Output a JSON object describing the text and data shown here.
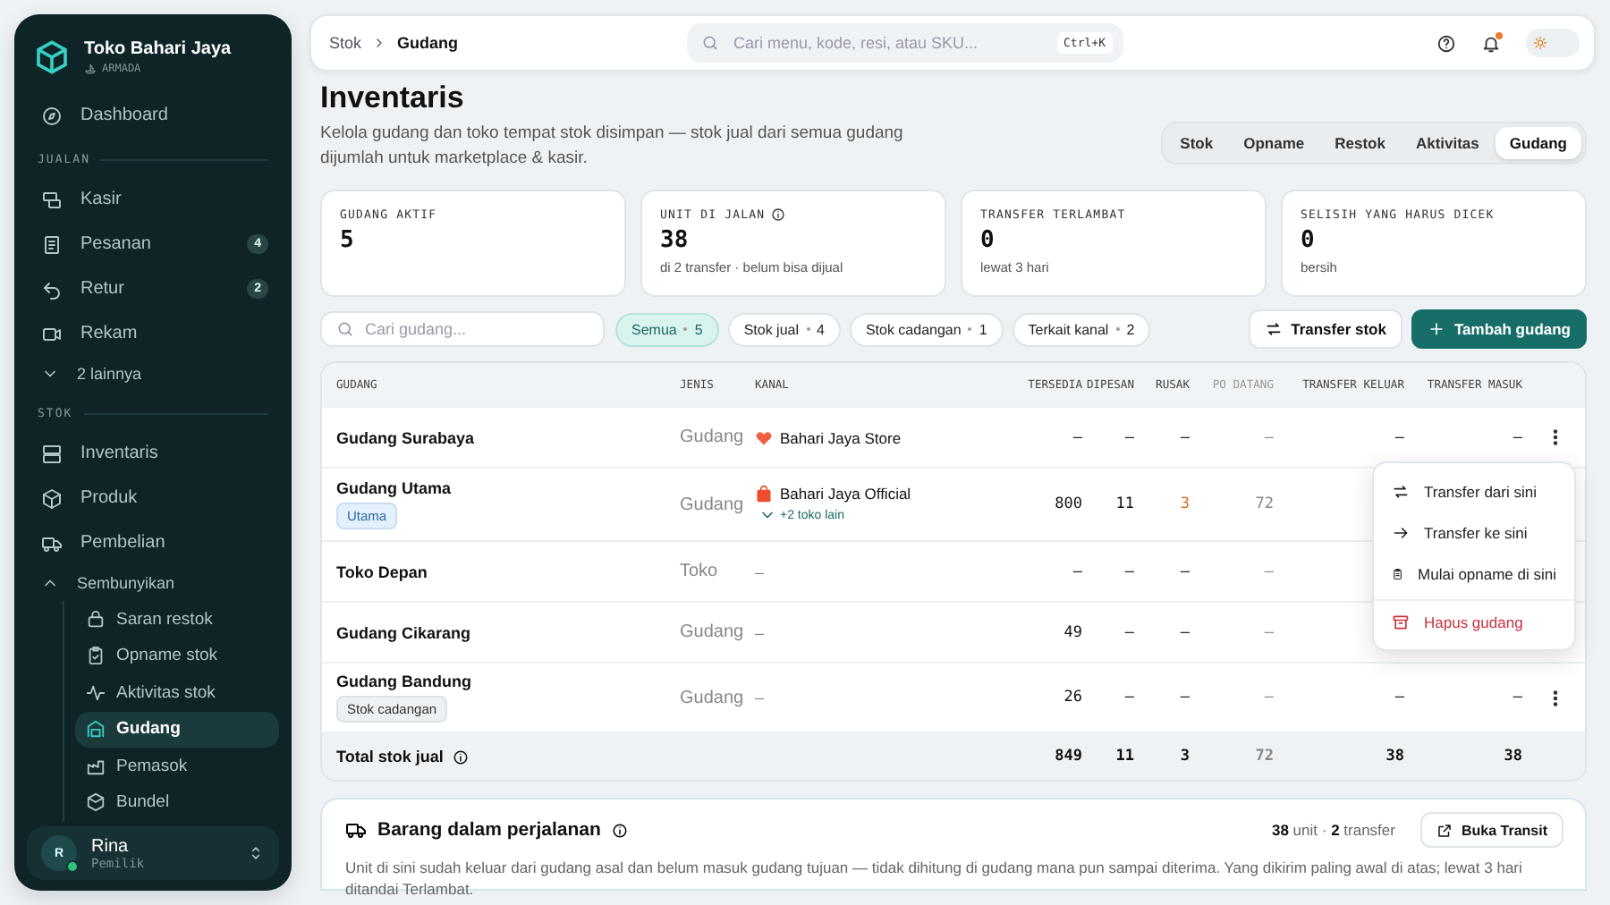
{
  "brand": {
    "name": "Toko Bahari Jaya",
    "sub": "ARMADA"
  },
  "nav": [
    {
      "kind": "item",
      "label": "Dashboard",
      "selected": false
    },
    {
      "kind": "section",
      "label": "JUALAN"
    },
    {
      "kind": "item",
      "label": "Kasir",
      "selected": false
    },
    {
      "kind": "item",
      "label": "Pesanan",
      "badge": "4",
      "selected": false
    },
    {
      "kind": "item",
      "label": "Retur",
      "badge": "2",
      "selected": false
    },
    {
      "kind": "item",
      "label": "Rekam",
      "selected": false
    },
    {
      "kind": "toggle",
      "label": "2 lainnya",
      "expanded": false
    },
    {
      "kind": "section",
      "label": "STOK"
    },
    {
      "kind": "item",
      "label": "Inventaris",
      "selected": false
    },
    {
      "kind": "item",
      "label": "Produk",
      "selected": false
    },
    {
      "kind": "item",
      "label": "Pembelian",
      "selected": false
    },
    {
      "kind": "toggle",
      "label": "Sembunyikan",
      "expanded": true,
      "children": [
        {
          "label": "Saran restok",
          "selected": false
        },
        {
          "label": "Opname stok",
          "selected": false
        },
        {
          "label": "Aktivitas stok",
          "selected": false
        },
        {
          "label": "Gudang",
          "selected": true
        },
        {
          "label": "Pemasok",
          "selected": false
        },
        {
          "label": "Bundel",
          "selected": false
        }
      ]
    }
  ],
  "user": {
    "initial": "R",
    "name": "Rina",
    "role": "Pemilik"
  },
  "topbar": {
    "breadcrumb": [
      "Stok",
      "Gudang"
    ],
    "search": {
      "placeholder": "Cari menu, kode, resi, atau SKU...",
      "shortcut": "Ctrl+K"
    },
    "notification": true,
    "dark_mode": false
  },
  "page": {
    "title": "Inventaris",
    "description": "Kelola gudang dan toko tempat stok disimpan — stok jual dari semua gudang dijumlah untuk marketplace & kasir.",
    "tabs": [
      {
        "label": "Stok",
        "selected": false
      },
      {
        "label": "Opname",
        "selected": false
      },
      {
        "label": "Restok",
        "selected": false
      },
      {
        "label": "Aktivitas",
        "selected": false
      },
      {
        "label": "Gudang",
        "selected": true
      }
    ]
  },
  "stats": [
    {
      "label": "GUDANG AKTIF",
      "value": "5",
      "info": false
    },
    {
      "label": "UNIT DI JALAN",
      "value": "38",
      "note": "di 2 transfer · belum bisa dijual",
      "info": true
    },
    {
      "label": "TRANSFER TERLAMBAT",
      "value": "0",
      "note": "lewat 3 hari",
      "info": false
    },
    {
      "label": "SELISIH YANG HARUS DICEK",
      "value": "0",
      "note": "bersih",
      "info": false
    }
  ],
  "filters": {
    "search": {
      "placeholder": "Cari gudang..."
    },
    "chips": [
      {
        "label": "Semua",
        "count": "5",
        "selected": true
      },
      {
        "label": "Stok jual",
        "count": "4",
        "selected": false
      },
      {
        "label": "Stok cadangan",
        "count": "1",
        "selected": false
      },
      {
        "label": "Terkait kanal",
        "count": "2",
        "selected": false
      }
    ],
    "buttons": [
      {
        "label": "Transfer stok",
        "kind": "secondary"
      },
      {
        "label": "Tambah gudang",
        "kind": "primary"
      }
    ]
  },
  "table": {
    "columns": [
      {
        "label": "GUDANG",
        "muted": false
      },
      {
        "label": "JENIS",
        "muted": false
      },
      {
        "label": "KANAL",
        "muted": false
      },
      {
        "label": "TERSEDIA",
        "muted": false
      },
      {
        "label": "DIPESAN",
        "muted": false
      },
      {
        "label": "RUSAK",
        "muted": false
      },
      {
        "label": "PO DATANG",
        "muted": true
      },
      {
        "label": "TRANSFER KELUAR",
        "muted": false
      },
      {
        "label": "TRANSFER MASUK",
        "muted": false
      }
    ],
    "rows": [
      {
        "name": "Gudang Surabaya",
        "type": "Gudang",
        "channels": [
          {
            "name": "Bahari Jaya Store",
            "kind": "heart"
          }
        ],
        "quantities": [
          "–",
          "–",
          "–",
          "–",
          "–",
          "–"
        ],
        "damaged_alert": false,
        "actions": true
      },
      {
        "name": "Gudang Utama",
        "tag": {
          "label": "Utama",
          "kind": "primary"
        },
        "type": "Gudang",
        "channels": [
          {
            "name": "Bahari Jaya Official",
            "kind": "bag"
          }
        ],
        "more_channels": {
          "label": "+2 toko lain",
          "expanded": false
        },
        "quantities": [
          "800",
          "11",
          "3",
          "72"
        ],
        "damaged_alert": true,
        "actions": false
      },
      {
        "name": "Toko Depan",
        "type": "Toko",
        "no_channel": "–",
        "quantities": [
          "–",
          "–",
          "–",
          "–"
        ],
        "damaged_alert": false,
        "actions": false
      },
      {
        "name": "Gudang Cikarang",
        "type": "Gudang",
        "no_channel": "–",
        "quantities": [
          "49",
          "–",
          "–",
          "–"
        ],
        "damaged_alert": false,
        "actions": false
      },
      {
        "name": "Gudang Bandung",
        "tag": {
          "label": "Stok cadangan",
          "kind": "reserve"
        },
        "type": "Gudang",
        "no_channel": "–",
        "quantities": [
          "26",
          "–",
          "–",
          "–",
          "–",
          "–"
        ],
        "damaged_alert": false,
        "actions": true
      }
    ],
    "total": {
      "label": "Total stok jual",
      "quantities": [
        "849",
        "11",
        "3",
        "72",
        "38",
        "38"
      ]
    },
    "menu": {
      "items": [
        {
          "label": "Transfer dari sini",
          "kind": "normal"
        },
        {
          "label": "Transfer ke sini",
          "kind": "normal"
        },
        {
          "label": "Mulai opname di sini",
          "kind": "normal"
        },
        {
          "label": "Hapus gudang",
          "kind": "danger"
        }
      ]
    }
  },
  "transit": {
    "title": "Barang dalam perjalanan",
    "summary": "**38** unit · **2** transfer",
    "button": "Buka Transit",
    "description": "Unit di sini sudah keluar dari gudang asal dan belum masuk gudang tujuan — tidak dihitung di gudang mana pun sampai diterima. Yang dikirim paling awal di atas; lewat 3 hari ditandai Terlambat."
  }
}
